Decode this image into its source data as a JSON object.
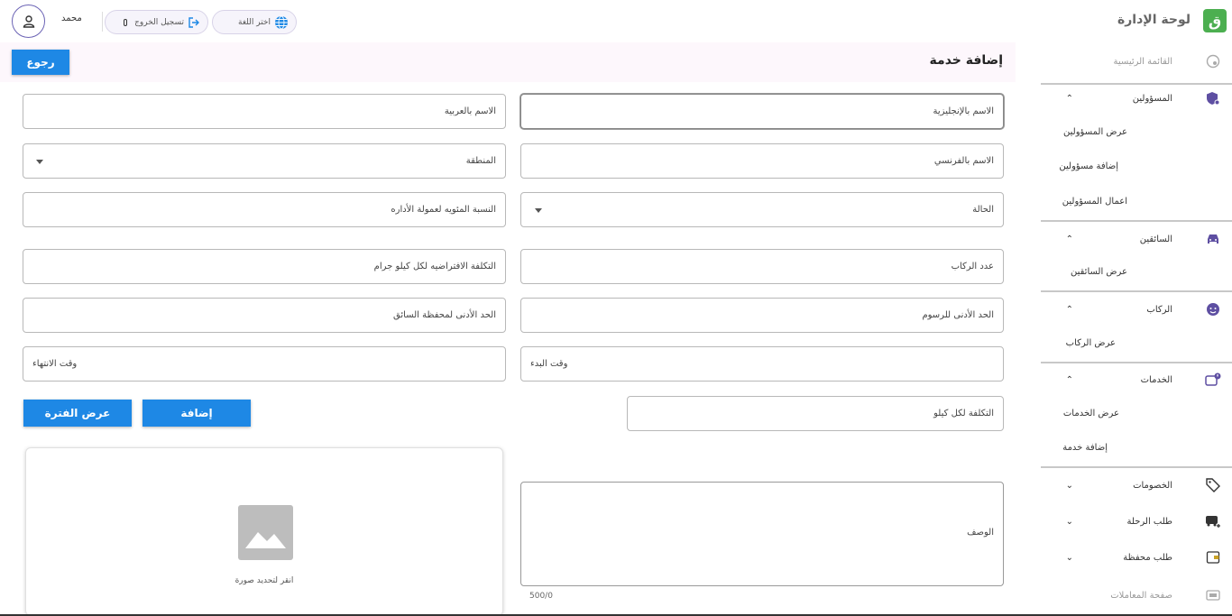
{
  "header": {
    "title": "لوحة الإدارة",
    "user_name": "محمد",
    "logout_label": "تسجيل الخروج",
    "language_label": "اختر اللغة"
  },
  "page": {
    "title": "إضافة خدمة",
    "back_label": "رجوع"
  },
  "form": {
    "name_en": "الاسم بالإنجليزية",
    "name_ar": "الاسم بالعربية",
    "name_fr": "الاسم بالفرنسي",
    "region": "المنطقة",
    "status": "الحالة",
    "admin_commission": "النسبة المئويه لعمولة الأداره",
    "passengers": "عدد الركاب",
    "default_cost_kg": "التكلفة الافتراضيه لكل كيلو جرام",
    "min_fees": "الحد الأدنى للرسوم",
    "min_driver_wallet": "الحد الأدنى لمحفظة السائق",
    "start_time": "وقت البدء",
    "end_time": "وقت الانتهاء",
    "cost_per_km": "التكلفة لكل كيلو",
    "add_label": "إضافة",
    "show_period_label": "عرض الفترة",
    "image_caption": "انقر لتحديد صورة",
    "description": "الوصف",
    "counter": "500/0"
  },
  "sidebar": {
    "home": "القائمة الرئيسية",
    "admins": "المسؤولين",
    "admins_view": "عرض المسؤولين",
    "admins_add": "إضافة مسؤولين",
    "admins_actions": "اعمال المسؤولين",
    "drivers": "السائقين",
    "drivers_view": "عرض السائقين",
    "riders": "الركاب",
    "riders_view": "عرض الركاب",
    "services": "الخدمات",
    "services_view": "عرض الخدمات",
    "services_add": "إضافة خدمة",
    "discounts": "الخصومات",
    "trip_request": "طلب الرحلة",
    "wallet_request": "طلب محفظة",
    "transactions": "صفحة المعاملات"
  },
  "colors": {
    "accent": "#1e88e5",
    "sidebar_icon": "#5e4fa2",
    "logo": "#4caf50"
  }
}
